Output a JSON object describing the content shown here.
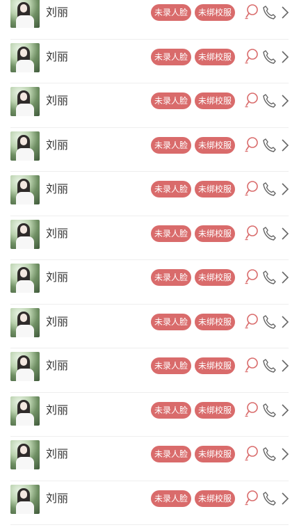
{
  "rows": [
    {
      "name": "刘丽",
      "tag_face": "未录人脸",
      "tag_uniform": "未绑校服"
    },
    {
      "name": "刘丽",
      "tag_face": "未录人脸",
      "tag_uniform": "未绑校服"
    },
    {
      "name": "刘丽",
      "tag_face": "未录人脸",
      "tag_uniform": "未绑校服"
    },
    {
      "name": "刘丽",
      "tag_face": "未录人脸",
      "tag_uniform": "未绑校服"
    },
    {
      "name": "刘丽",
      "tag_face": "未录人脸",
      "tag_uniform": "未绑校服"
    },
    {
      "name": "刘丽",
      "tag_face": "未录人脸",
      "tag_uniform": "未绑校服"
    },
    {
      "name": "刘丽",
      "tag_face": "未录人脸",
      "tag_uniform": "未绑校服"
    },
    {
      "name": "刘丽",
      "tag_face": "未录人脸",
      "tag_uniform": "未绑校服"
    },
    {
      "name": "刘丽",
      "tag_face": "未录人脸",
      "tag_uniform": "未绑校服"
    },
    {
      "name": "刘丽",
      "tag_face": "未录人脸",
      "tag_uniform": "未绑校服"
    },
    {
      "name": "刘丽",
      "tag_face": "未录人脸",
      "tag_uniform": "未绑校服"
    },
    {
      "name": "刘丽",
      "tag_face": "未录人脸",
      "tag_uniform": "未绑校服"
    }
  ],
  "icons": {
    "avatar": "student-photo",
    "locate": "location-search-icon",
    "phone": "phone-icon",
    "chevron": "chevron-right-icon"
  },
  "colors": {
    "badge_bg": "#d96b6b",
    "badge_text": "#ffffff",
    "locate_icon": "#d96b6b",
    "secondary_icon": "#666666",
    "divider": "#eeeeee"
  }
}
